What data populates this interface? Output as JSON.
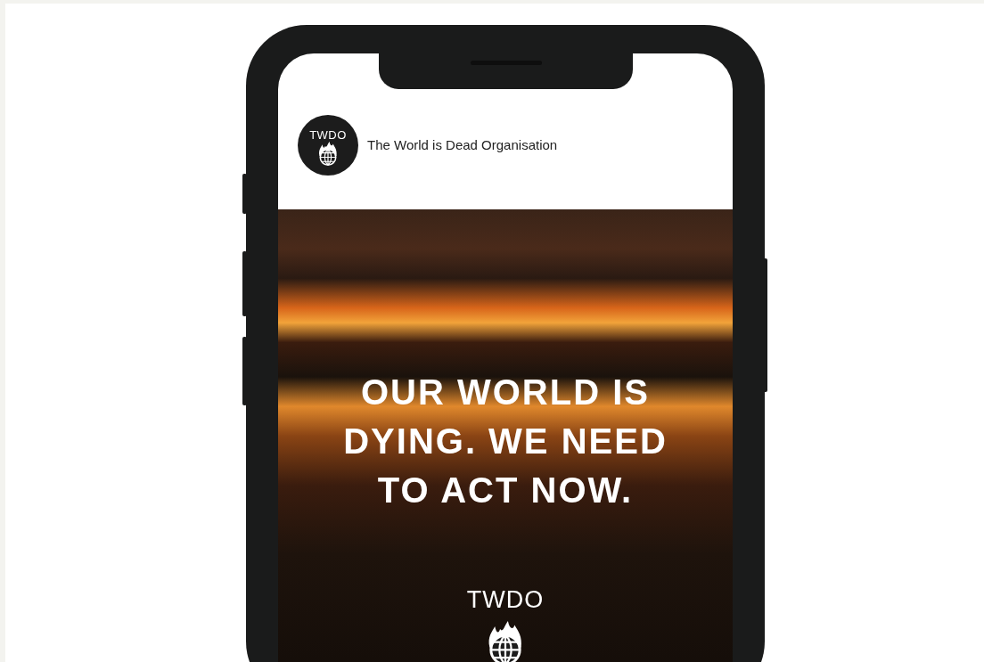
{
  "post": {
    "avatar_label": "TWDO",
    "account_name": "The World is Dead Organisation",
    "image": {
      "headline": "OUR WORLD IS DYING. WE NEED TO ACT NOW.",
      "logo_text": "TWDO"
    }
  }
}
